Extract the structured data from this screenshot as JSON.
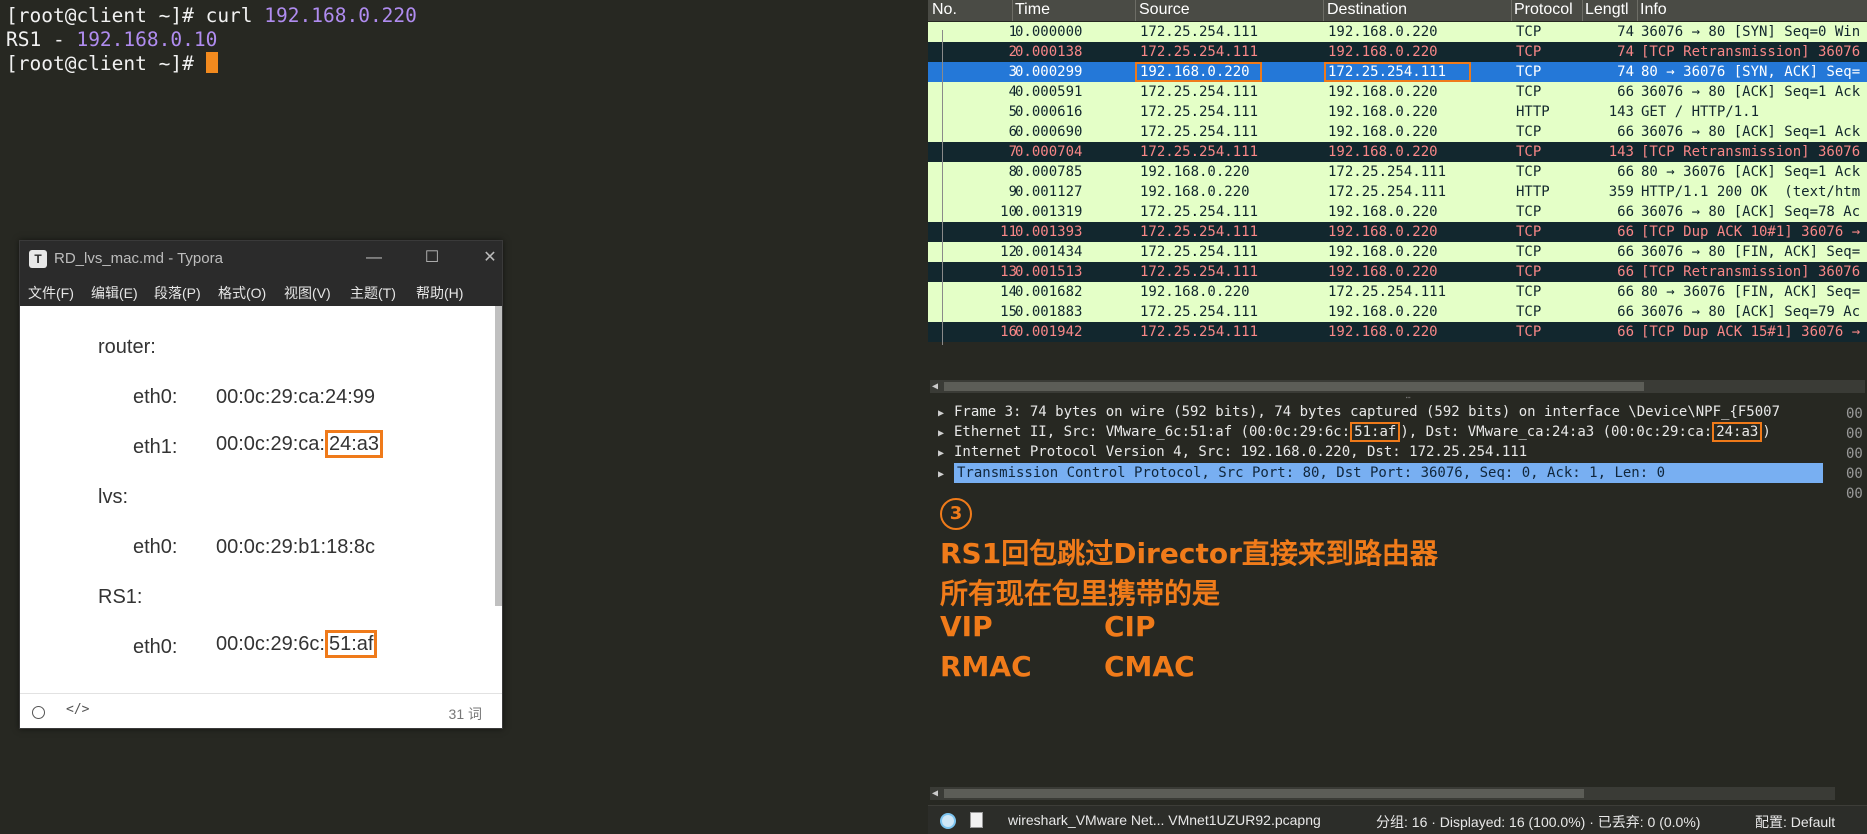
{
  "terminal": {
    "line1_prompt": "[root@client ~]# curl ",
    "line1_ip": "192.168.0.220",
    "line2_label": "RS1 - ",
    "line2_ip": "192.168.0.10",
    "line3_prompt": "[root@client ~]# "
  },
  "typora": {
    "logo": "T",
    "title": "RD_lvs_mac.md - Typora",
    "minimize": "—",
    "maximize": "☐",
    "close": "✕",
    "menu": [
      "文件(F)",
      "编辑(E)",
      "段落(P)",
      "格式(O)",
      "视图(V)",
      "主题(T)",
      "帮助(H)"
    ],
    "doc": {
      "router_heading": "router:",
      "router_eth0_key": "eth0:",
      "router_eth0_val": "00:0c:29:ca:24:99",
      "router_eth1_key": "eth1:",
      "router_eth1_val_prefix": "00:0c:29:ca:",
      "router_eth1_val_highlight": "24:a3",
      "lvs_heading": "lvs:",
      "lvs_eth0_key": "eth0:",
      "lvs_eth0_val": "00:0c:29:b1:18:8c",
      "rs1_heading": "RS1:",
      "rs1_eth0_key": "eth0:",
      "rs1_eth0_val_prefix": "00:0c:29:6c:",
      "rs1_eth0_val_highlight": "51:af"
    },
    "status": {
      "code_icon": "</>",
      "words": "31 词"
    }
  },
  "wireshark": {
    "columns": [
      "No.",
      "Time",
      "Source",
      "Destination",
      "Protocol",
      "Length",
      "Info"
    ],
    "columns_display": [
      "No.",
      "Time",
      "Source",
      "Destination",
      "Protocol",
      "Lengtl",
      "Info"
    ],
    "packets": [
      {
        "no": "1",
        "time": "0.000000",
        "src": "172.25.254.111",
        "dst": "192.168.0.220",
        "proto": "TCP",
        "len": "74",
        "info": "36076 → 80 [SYN] Seq=0 Win",
        "style": "green"
      },
      {
        "no": "2",
        "time": "0.000138",
        "src": "172.25.254.111",
        "dst": "192.168.0.220",
        "proto": "TCP",
        "len": "74",
        "info": "[TCP Retransmission] 36076",
        "style": "dark"
      },
      {
        "no": "3",
        "time": "0.000299",
        "src": "192.168.0.220",
        "dst": "172.25.254.111",
        "proto": "TCP",
        "len": "74",
        "info": "80 → 36076 [SYN, ACK] Seq=",
        "style": "selected"
      },
      {
        "no": "4",
        "time": "0.000591",
        "src": "172.25.254.111",
        "dst": "192.168.0.220",
        "proto": "TCP",
        "len": "66",
        "info": "36076 → 80 [ACK] Seq=1 Ack",
        "style": "green"
      },
      {
        "no": "5",
        "time": "0.000616",
        "src": "172.25.254.111",
        "dst": "192.168.0.220",
        "proto": "HTTP",
        "len": "143",
        "info": "GET / HTTP/1.1",
        "style": "green"
      },
      {
        "no": "6",
        "time": "0.000690",
        "src": "172.25.254.111",
        "dst": "192.168.0.220",
        "proto": "TCP",
        "len": "66",
        "info": "36076 → 80 [ACK] Seq=1 Ack",
        "style": "green"
      },
      {
        "no": "7",
        "time": "0.000704",
        "src": "172.25.254.111",
        "dst": "192.168.0.220",
        "proto": "TCP",
        "len": "143",
        "info": "[TCP Retransmission] 36076",
        "style": "dark"
      },
      {
        "no": "8",
        "time": "0.000785",
        "src": "192.168.0.220",
        "dst": "172.25.254.111",
        "proto": "TCP",
        "len": "66",
        "info": "80 → 36076 [ACK] Seq=1 Ack",
        "style": "green"
      },
      {
        "no": "9",
        "time": "0.001127",
        "src": "192.168.0.220",
        "dst": "172.25.254.111",
        "proto": "HTTP",
        "len": "359",
        "info": "HTTP/1.1 200 OK  (text/htm",
        "style": "green"
      },
      {
        "no": "10",
        "time": "0.001319",
        "src": "172.25.254.111",
        "dst": "192.168.0.220",
        "proto": "TCP",
        "len": "66",
        "info": "36076 → 80 [ACK] Seq=78 Ac",
        "style": "green"
      },
      {
        "no": "11",
        "time": "0.001393",
        "src": "172.25.254.111",
        "dst": "192.168.0.220",
        "proto": "TCP",
        "len": "66",
        "info": "[TCP Dup ACK 10#1] 36076 →",
        "style": "dark"
      },
      {
        "no": "12",
        "time": "0.001434",
        "src": "172.25.254.111",
        "dst": "192.168.0.220",
        "proto": "TCP",
        "len": "66",
        "info": "36076 → 80 [FIN, ACK] Seq=",
        "style": "green"
      },
      {
        "no": "13",
        "time": "0.001513",
        "src": "172.25.254.111",
        "dst": "192.168.0.220",
        "proto": "TCP",
        "len": "66",
        "info": "[TCP Retransmission] 36076",
        "style": "dark"
      },
      {
        "no": "14",
        "time": "0.001682",
        "src": "192.168.0.220",
        "dst": "172.25.254.111",
        "proto": "TCP",
        "len": "66",
        "info": "80 → 36076 [FIN, ACK] Seq=",
        "style": "green"
      },
      {
        "no": "15",
        "time": "0.001883",
        "src": "172.25.254.111",
        "dst": "192.168.0.220",
        "proto": "TCP",
        "len": "66",
        "info": "36076 → 80 [ACK] Seq=79 Ac",
        "style": "green"
      },
      {
        "no": "16",
        "time": "0.001942",
        "src": "172.25.254.111",
        "dst": "192.168.0.220",
        "proto": "TCP",
        "len": "66",
        "info": "[TCP Dup ACK 15#1] 36076 →",
        "style": "dark"
      }
    ],
    "details": {
      "frame": "Frame 3: 74 bytes on wire (592 bits), 74 bytes captured (592 bits) on interface \\Device\\NPF_{F5007",
      "eth_a": "Ethernet II, Src: VMware_6c:51:af (00:0c:29:6c:",
      "eth_b": "51:af",
      "eth_c": "), Dst: VMware_ca:24:a3 (00:0c:29:ca:",
      "eth_d": "24:a3",
      "eth_e": ")",
      "ip": "Internet Protocol Version 4, Src: 192.168.0.220, Dst: 172.25.254.111",
      "tcp": "Transmission Control Protocol, Src Port: 80, Dst Port: 36076, Seq: 0, Ack: 1, Len: 0"
    },
    "hex_prefix": [
      "00",
      "00",
      "00",
      "00",
      "00"
    ],
    "annotation": {
      "number": "3",
      "line1": "RS1回包跳过Director直接来到路由器",
      "line2": "所有现在包里携带的是",
      "line3_a": "VIP",
      "line3_b": "CIP",
      "line4_a": "RMAC",
      "line4_b": "CMAC"
    },
    "status": {
      "file": "wireshark_VMware Net... VMnet1UZUR92.pcapng",
      "counts": "分组: 16 · Displayed: 16 (100.0%) · 已丢弃: 0 (0.0%)",
      "profile": "配置: Default"
    }
  },
  "colors": {
    "accent_orange": "#ef7a1a",
    "terminal_bg": "#272822",
    "ip_purple": "#b08cf0",
    "row_green": "#e4ffc7",
    "row_dark": "#12272e",
    "row_selected": "#2478d8",
    "detail_selected": "#78aff2"
  }
}
